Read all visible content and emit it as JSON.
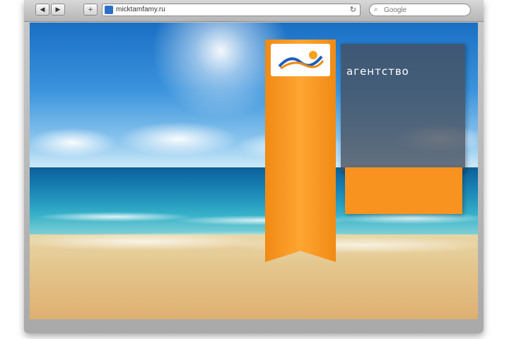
{
  "browser": {
    "back_label": "◀",
    "forward_label": "▶",
    "add_label": "+",
    "url": "micktamfamy.ru",
    "reload_label": "↻",
    "search_placeholder": "Google"
  },
  "page": {
    "logo": {
      "text": "LOGO"
    },
    "watermark": "",
    "nav_heading": "",
    "nav_groups": [],
    "info": {
      "kicker": "",
      "title1": "",
      "title2": "агентство",
      "lines": []
    },
    "note_lines": []
  },
  "colors": {
    "ribbon": "#f7931e",
    "info_panel": "#4a5361",
    "sky": "#2a86d6",
    "sand": "#e4c58c"
  }
}
